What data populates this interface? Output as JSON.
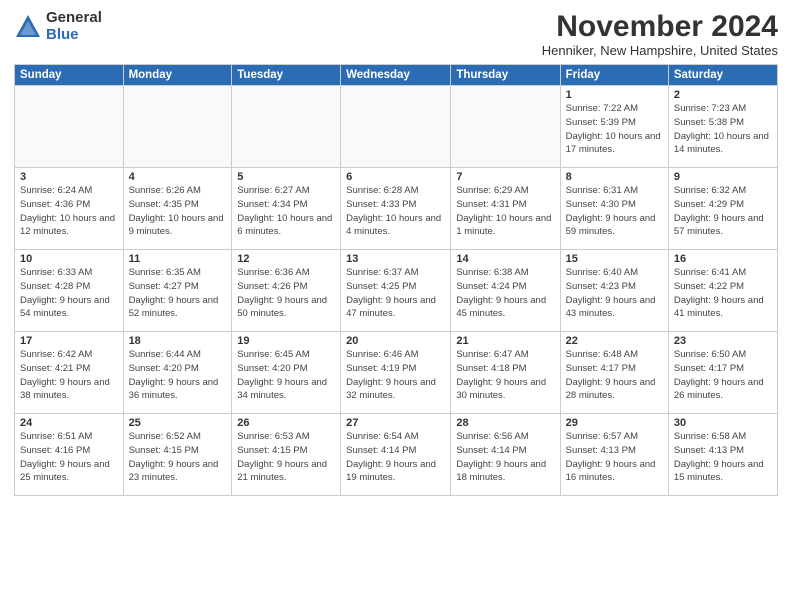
{
  "logo": {
    "general": "General",
    "blue": "Blue"
  },
  "title": "November 2024",
  "location": "Henniker, New Hampshire, United States",
  "days_of_week": [
    "Sunday",
    "Monday",
    "Tuesday",
    "Wednesday",
    "Thursday",
    "Friday",
    "Saturday"
  ],
  "weeks": [
    [
      {
        "day": "",
        "info": ""
      },
      {
        "day": "",
        "info": ""
      },
      {
        "day": "",
        "info": ""
      },
      {
        "day": "",
        "info": ""
      },
      {
        "day": "",
        "info": ""
      },
      {
        "day": "1",
        "info": "Sunrise: 7:22 AM\nSunset: 5:39 PM\nDaylight: 10 hours and 17 minutes."
      },
      {
        "day": "2",
        "info": "Sunrise: 7:23 AM\nSunset: 5:38 PM\nDaylight: 10 hours and 14 minutes."
      }
    ],
    [
      {
        "day": "3",
        "info": "Sunrise: 6:24 AM\nSunset: 4:36 PM\nDaylight: 10 hours and 12 minutes."
      },
      {
        "day": "4",
        "info": "Sunrise: 6:26 AM\nSunset: 4:35 PM\nDaylight: 10 hours and 9 minutes."
      },
      {
        "day": "5",
        "info": "Sunrise: 6:27 AM\nSunset: 4:34 PM\nDaylight: 10 hours and 6 minutes."
      },
      {
        "day": "6",
        "info": "Sunrise: 6:28 AM\nSunset: 4:33 PM\nDaylight: 10 hours and 4 minutes."
      },
      {
        "day": "7",
        "info": "Sunrise: 6:29 AM\nSunset: 4:31 PM\nDaylight: 10 hours and 1 minute."
      },
      {
        "day": "8",
        "info": "Sunrise: 6:31 AM\nSunset: 4:30 PM\nDaylight: 9 hours and 59 minutes."
      },
      {
        "day": "9",
        "info": "Sunrise: 6:32 AM\nSunset: 4:29 PM\nDaylight: 9 hours and 57 minutes."
      }
    ],
    [
      {
        "day": "10",
        "info": "Sunrise: 6:33 AM\nSunset: 4:28 PM\nDaylight: 9 hours and 54 minutes."
      },
      {
        "day": "11",
        "info": "Sunrise: 6:35 AM\nSunset: 4:27 PM\nDaylight: 9 hours and 52 minutes."
      },
      {
        "day": "12",
        "info": "Sunrise: 6:36 AM\nSunset: 4:26 PM\nDaylight: 9 hours and 50 minutes."
      },
      {
        "day": "13",
        "info": "Sunrise: 6:37 AM\nSunset: 4:25 PM\nDaylight: 9 hours and 47 minutes."
      },
      {
        "day": "14",
        "info": "Sunrise: 6:38 AM\nSunset: 4:24 PM\nDaylight: 9 hours and 45 minutes."
      },
      {
        "day": "15",
        "info": "Sunrise: 6:40 AM\nSunset: 4:23 PM\nDaylight: 9 hours and 43 minutes."
      },
      {
        "day": "16",
        "info": "Sunrise: 6:41 AM\nSunset: 4:22 PM\nDaylight: 9 hours and 41 minutes."
      }
    ],
    [
      {
        "day": "17",
        "info": "Sunrise: 6:42 AM\nSunset: 4:21 PM\nDaylight: 9 hours and 38 minutes."
      },
      {
        "day": "18",
        "info": "Sunrise: 6:44 AM\nSunset: 4:20 PM\nDaylight: 9 hours and 36 minutes."
      },
      {
        "day": "19",
        "info": "Sunrise: 6:45 AM\nSunset: 4:20 PM\nDaylight: 9 hours and 34 minutes."
      },
      {
        "day": "20",
        "info": "Sunrise: 6:46 AM\nSunset: 4:19 PM\nDaylight: 9 hours and 32 minutes."
      },
      {
        "day": "21",
        "info": "Sunrise: 6:47 AM\nSunset: 4:18 PM\nDaylight: 9 hours and 30 minutes."
      },
      {
        "day": "22",
        "info": "Sunrise: 6:48 AM\nSunset: 4:17 PM\nDaylight: 9 hours and 28 minutes."
      },
      {
        "day": "23",
        "info": "Sunrise: 6:50 AM\nSunset: 4:17 PM\nDaylight: 9 hours and 26 minutes."
      }
    ],
    [
      {
        "day": "24",
        "info": "Sunrise: 6:51 AM\nSunset: 4:16 PM\nDaylight: 9 hours and 25 minutes."
      },
      {
        "day": "25",
        "info": "Sunrise: 6:52 AM\nSunset: 4:15 PM\nDaylight: 9 hours and 23 minutes."
      },
      {
        "day": "26",
        "info": "Sunrise: 6:53 AM\nSunset: 4:15 PM\nDaylight: 9 hours and 21 minutes."
      },
      {
        "day": "27",
        "info": "Sunrise: 6:54 AM\nSunset: 4:14 PM\nDaylight: 9 hours and 19 minutes."
      },
      {
        "day": "28",
        "info": "Sunrise: 6:56 AM\nSunset: 4:14 PM\nDaylight: 9 hours and 18 minutes."
      },
      {
        "day": "29",
        "info": "Sunrise: 6:57 AM\nSunset: 4:13 PM\nDaylight: 9 hours and 16 minutes."
      },
      {
        "day": "30",
        "info": "Sunrise: 6:58 AM\nSunset: 4:13 PM\nDaylight: 9 hours and 15 minutes."
      }
    ]
  ]
}
